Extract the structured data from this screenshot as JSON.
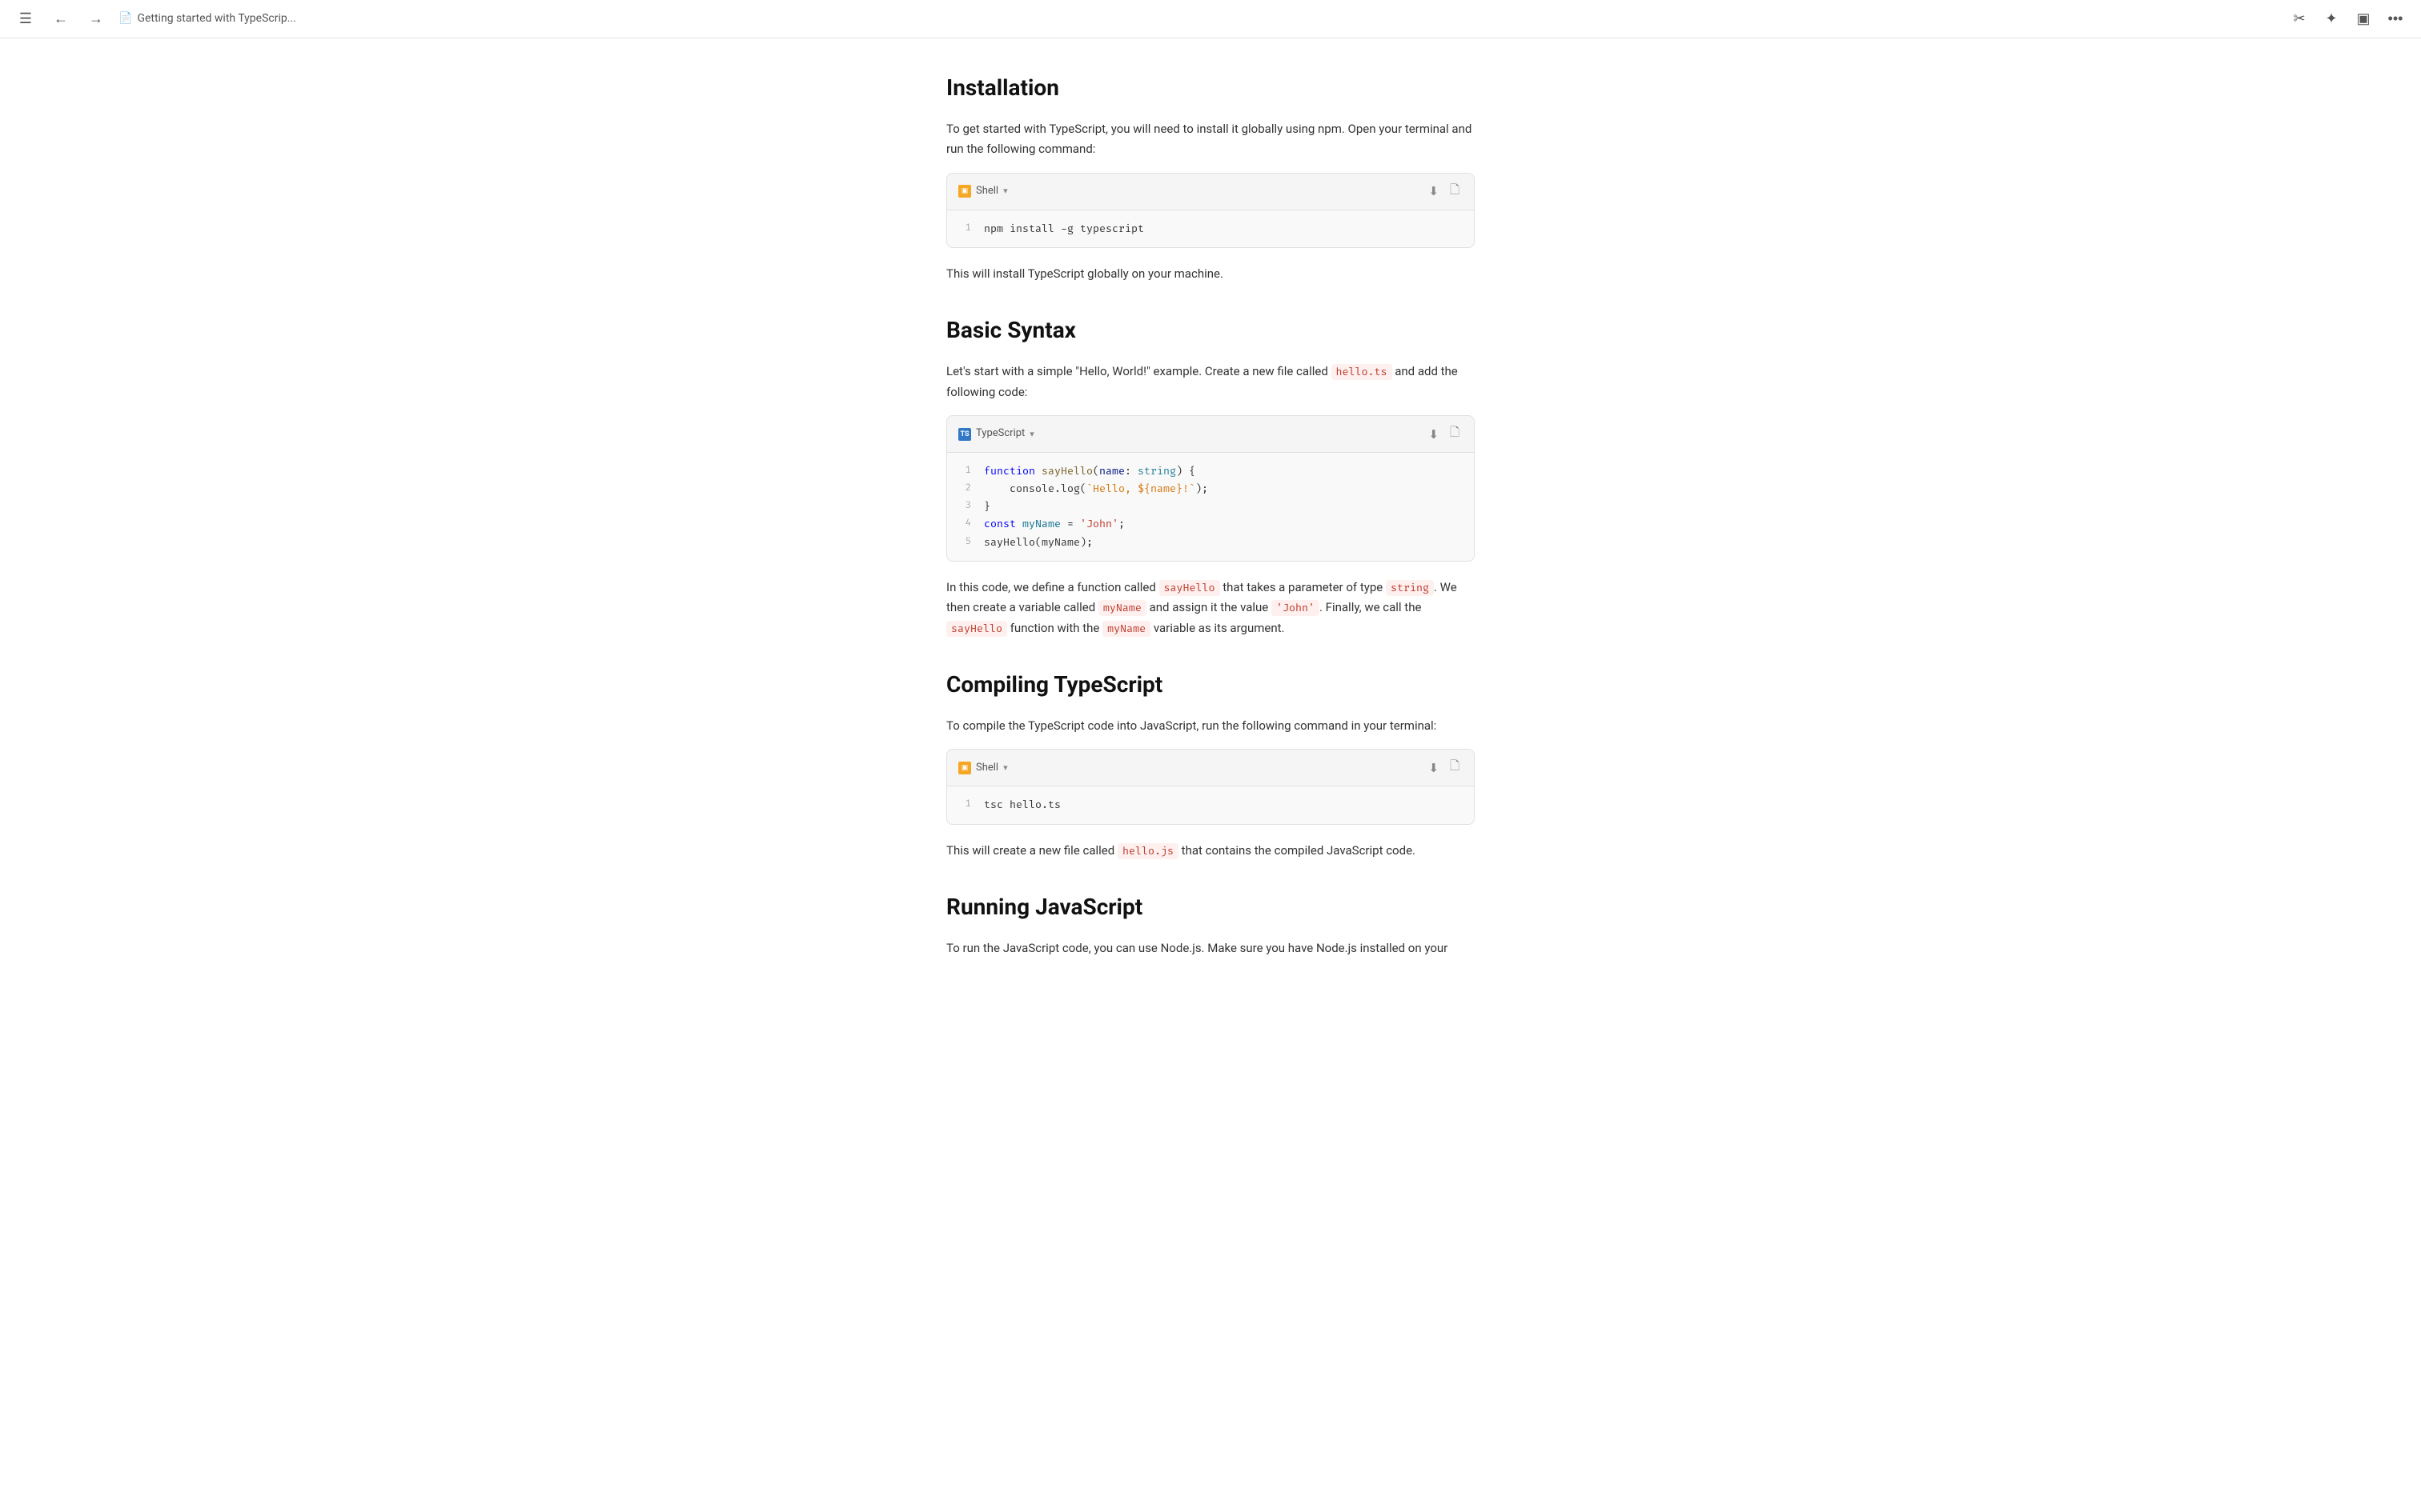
{
  "topbar": {
    "breadcrumb_text": "Getting started with TypeScrip...",
    "sidebar_icon": "☰",
    "back_icon": "←",
    "forward_icon": "→",
    "doc_icon": "📄",
    "scissors_icon": "✂",
    "star_icon": "⭐",
    "layout_icon": "⊞",
    "more_icon": "···"
  },
  "content": {
    "section_installation": {
      "heading": "Installation",
      "paragraph1": "To get started with TypeScript, you will need to install it globally using npm. Open your terminal and run the following command:",
      "code_block_1": {
        "lang": "Shell",
        "lang_icon": "shell",
        "line1_num": "1",
        "line1_code": "npm install -g typescript"
      },
      "paragraph2": "This will install TypeScript globally on your machine."
    },
    "section_basic_syntax": {
      "heading": "Basic Syntax",
      "paragraph1_before": "Let's start with a simple \"Hello, World!\" example. Create a new file called ",
      "paragraph1_code": "hello.ts",
      "paragraph1_after": " and add the following code:",
      "code_block_2": {
        "lang": "TypeScript",
        "lang_icon": "ts",
        "lines": [
          {
            "num": "1",
            "tokens": [
              {
                "t": "kw",
                "v": "function "
              },
              {
                "t": "fn",
                "v": "sayHello"
              },
              {
                "t": "plain",
                "v": "("
              },
              {
                "t": "param",
                "v": "name"
              },
              {
                "t": "plain",
                "v": ": "
              },
              {
                "t": "type",
                "v": "string"
              },
              {
                "t": "plain",
                "v": ") {"
              }
            ]
          },
          {
            "num": "2",
            "tokens": [
              {
                "t": "plain",
                "v": "    console.log("
              },
              {
                "t": "str",
                "v": "`Hello, ${name}!`"
              },
              {
                "t": "plain",
                "v": ");"
              }
            ]
          },
          {
            "num": "3",
            "tokens": [
              {
                "t": "plain",
                "v": "}"
              }
            ]
          },
          {
            "num": "4",
            "tokens": [
              {
                "t": "kw",
                "v": "const "
              },
              {
                "t": "var",
                "v": "myName"
              },
              {
                "t": "plain",
                "v": " = "
              },
              {
                "t": "strlit",
                "v": "'John'"
              },
              {
                "t": "plain",
                "v": ";"
              }
            ]
          },
          {
            "num": "5",
            "tokens": [
              {
                "t": "plain",
                "v": "sayHello(myName);"
              }
            ]
          }
        ]
      },
      "paragraph2_before": "In this code, we define a function called ",
      "paragraph2_code1": "sayHello",
      "paragraph2_mid1": " that takes a parameter of type ",
      "paragraph2_code2": "string",
      "paragraph2_mid2": ". We then create a variable called ",
      "paragraph2_code3": "myName",
      "paragraph2_mid3": " and assign it the value ",
      "paragraph2_code4": "'John'",
      "paragraph2_mid4": ". Finally, we call the ",
      "paragraph2_code5": "sayHello",
      "paragraph2_end": " function with the ",
      "paragraph2_code6": "myName",
      "paragraph2_end2": " variable as its argument."
    },
    "section_compiling": {
      "heading": "Compiling TypeScript",
      "paragraph1": "To compile the TypeScript code into JavaScript, run the following command in your terminal:",
      "code_block_3": {
        "lang": "Shell",
        "lang_icon": "shell",
        "line1_num": "1",
        "line1_code": "tsc hello.ts"
      },
      "paragraph2_before": "This will create a new file called ",
      "paragraph2_code": "hello.js",
      "paragraph2_after": " that contains the compiled JavaScript code."
    },
    "section_running": {
      "heading": "Running JavaScript",
      "paragraph1": "To run the JavaScript code, you can use Node.js. Make sure you have Node.js installed on your"
    }
  }
}
